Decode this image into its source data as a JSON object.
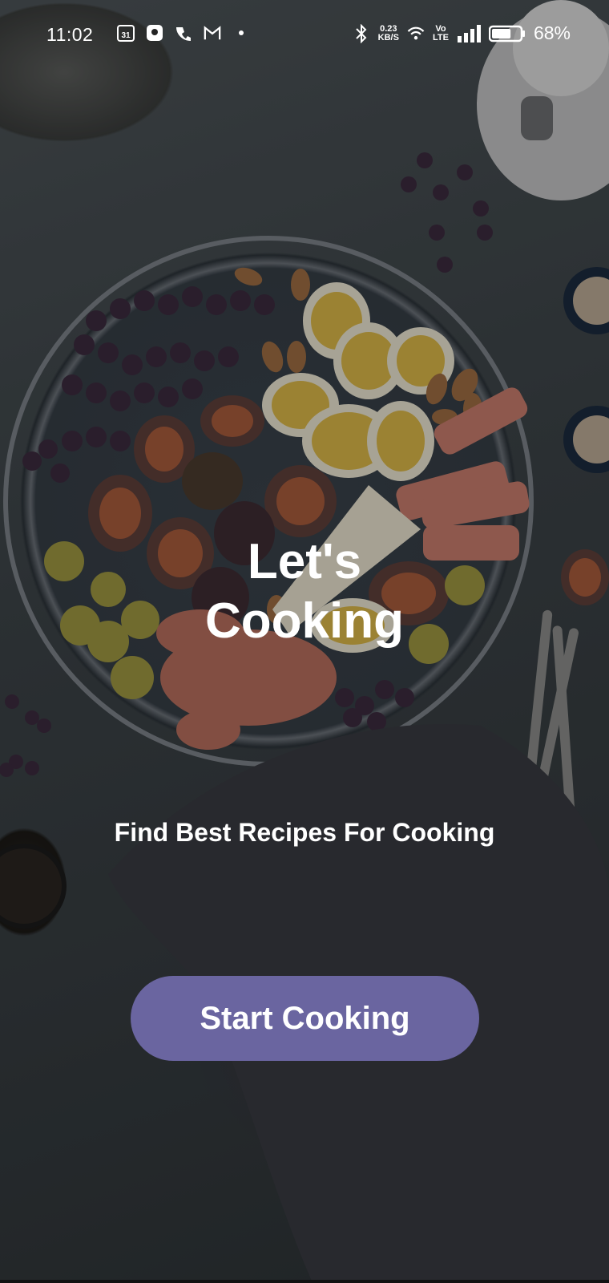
{
  "status_bar": {
    "time": "11:02",
    "net_speed_value": "0.23",
    "net_speed_unit": "KB/S",
    "volte_label": "Vo LTE",
    "battery_percent": "68%",
    "left_icons": [
      "calendar-31-icon",
      "app-icon",
      "phone-app-icon",
      "gmail-icon",
      "dot-icon"
    ],
    "right_icons": [
      "bluetooth-icon",
      "wifi-icon",
      "signal-icon",
      "battery-icon"
    ],
    "battery_level": 0.68
  },
  "hero": {
    "title_line1": "Let's",
    "title_line2": "Cooking"
  },
  "tagline": "Find Best Recipes For Cooking",
  "start_button": {
    "label": "Start Cooking",
    "color": "#6a65a0"
  },
  "colors": {
    "text": "#ffffff",
    "accent": "#6a65a0"
  }
}
